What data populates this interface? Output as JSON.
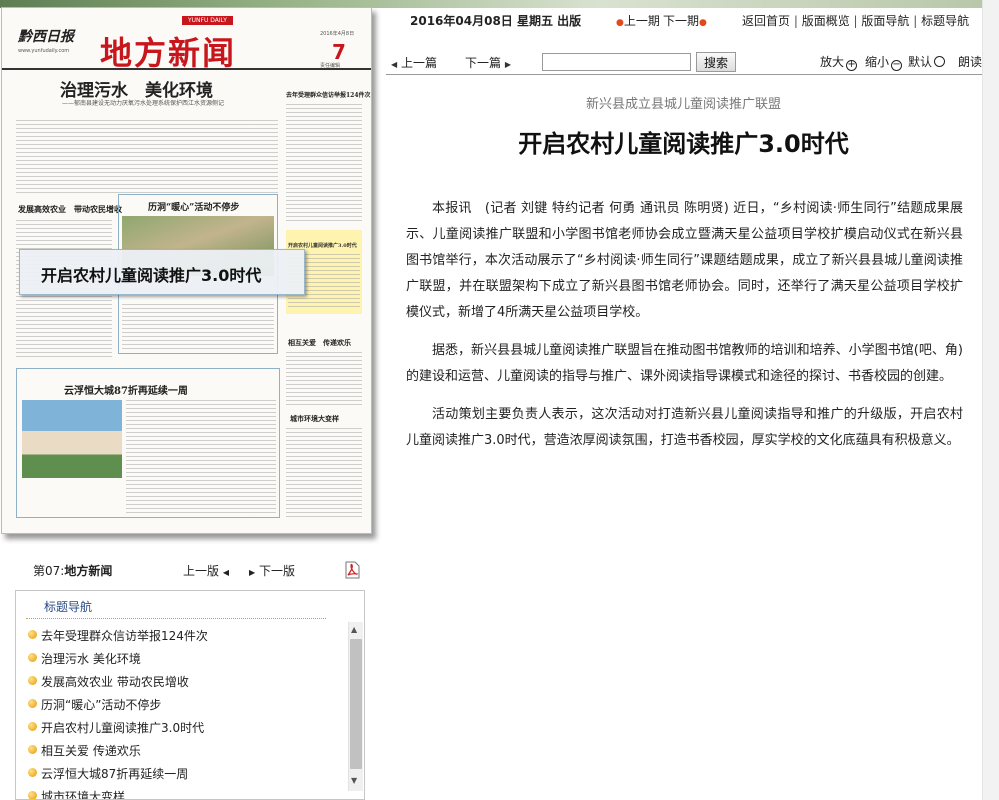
{
  "newspaper": {
    "logo": "黔西日报",
    "logo_sub": "www.yunfudaily.com",
    "daily_band": "YUNFU DAILY",
    "page_name": "地方新闻",
    "page_number": "7",
    "date_small": "2016年4月8日",
    "editor_small": "责任编辑",
    "headline_main": "治理污水　美化环境",
    "headline_main_sub": "——郁南县建设无动力厌氧污水处理系统保护西江水资源侧记",
    "headline_right": "去年受理群众信访举报124件次",
    "headline_left": "发展高效农业　带动农民增收",
    "headline_mid": "历洞“暖心”活动不停步",
    "headline_small": "开启农村儿童阅读推广3.0时代",
    "headline_care": "相互关爱　传递欢乐",
    "headline_estate": "云浮恒大城87折再延续一周",
    "headline_city": "城市环境大变样",
    "callout": "开启农村儿童阅读推广3.0时代"
  },
  "edition_nav": {
    "label_prefix": "第07:",
    "label_name": "地方新闻",
    "prev": "上一版",
    "next": "下一版"
  },
  "headline_nav": {
    "title": "标题导航",
    "items": [
      "去年受理群众信访举报124件次",
      "治理污水 美化环境",
      "发展高效农业 带动农民增收",
      "历洞“暖心”活动不停步",
      "开启农村儿童阅读推广3.0时代",
      "相互关爱 传递欢乐",
      "云浮恒大城87折再延续一周",
      "城市环境大变样"
    ]
  },
  "top_nav": {
    "date": "2016年04月08日 星期五 出版",
    "prev_page": "上一期",
    "next_page": "下一期",
    "links": [
      "返回首页",
      "版面概览",
      "版面导航",
      "标题导航"
    ]
  },
  "toolbar": {
    "prev_article": "上一篇",
    "next_article": "下一篇",
    "search_value": "",
    "search_button": "搜索",
    "zoom_in": "放大",
    "zoom_out": "缩小",
    "default": "默认",
    "read_aloud": "朗读"
  },
  "article": {
    "subtitle": "新兴县成立县城儿童阅读推广联盟",
    "title": "开启农村儿童阅读推广3.0时代",
    "paragraphs": [
      "本报讯　(记者 刘键 特约记者 何勇 通讯员 陈明贤) 近日，“乡村阅读·师生同行”结题成果展示、儿童阅读推广联盟和小学图书馆老师协会成立暨满天星公益项目学校扩模启动仪式在新兴县图书馆举行，本次活动展示了“乡村阅读·师生同行”课题结题成果，成立了新兴县县城儿童阅读推广联盟，并在联盟架构下成立了新兴县图书馆老师协会。同时，还举行了满天星公益项目学校扩模仪式，新增了4所满天星公益项目学校。",
      "据悉，新兴县县城儿童阅读推广联盟旨在推动图书馆教师的培训和培养、小学图书馆(吧、角)的建设和运营、儿童阅读的指导与推广、课外阅读指导课模式和途径的探讨、书香校园的创建。",
      "活动策划主要负责人表示，这次活动对打造新兴县儿童阅读指导和推广的升级版，开启农村儿童阅读推广3.0时代，营造浓厚阅读氛围，打造书香校园，厚实学校的文化底蕴具有积极意义。"
    ]
  },
  "colors": {
    "masthead_red": "#c8161d",
    "nav_title_blue": "#2a4a85",
    "highlight_yellow": "#fff2a6"
  }
}
